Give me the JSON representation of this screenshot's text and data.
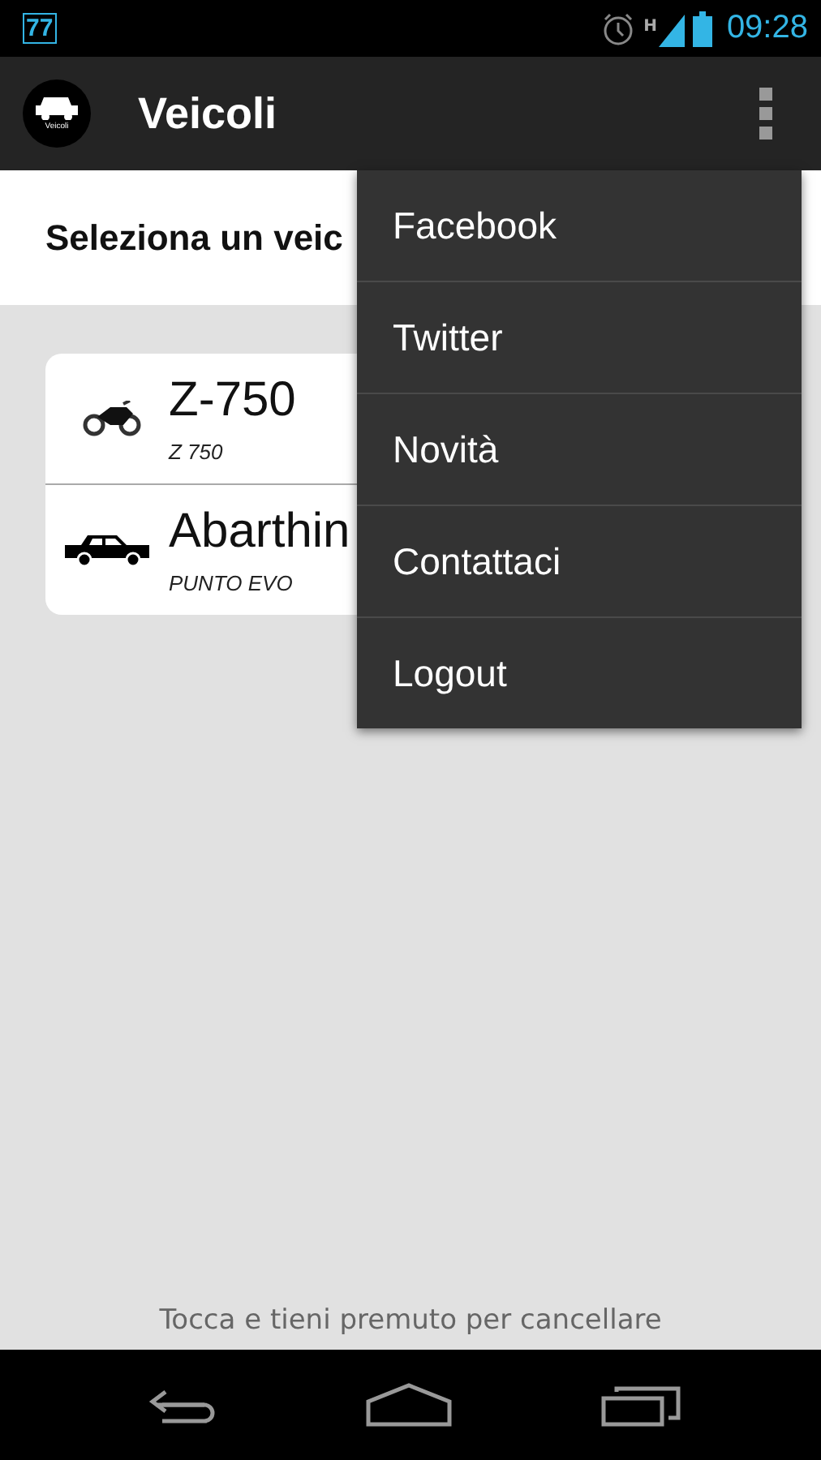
{
  "status_bar": {
    "notification": "77",
    "network": "H",
    "time": "09:28"
  },
  "app_bar": {
    "logo_text": "Veicoli",
    "title": "Veicoli"
  },
  "header": {
    "text": "Seleziona un veic"
  },
  "vehicles": [
    {
      "kind": "motorcycle",
      "name": "Z-750",
      "model": "Z 750"
    },
    {
      "kind": "car",
      "name": "Abarthin",
      "model": "PUNTO EVO"
    }
  ],
  "menu": {
    "items": [
      "Facebook",
      "Twitter",
      "Novità",
      "Contattaci",
      "Logout"
    ]
  },
  "hint": "Tocca e tieni premuto per cancellare"
}
